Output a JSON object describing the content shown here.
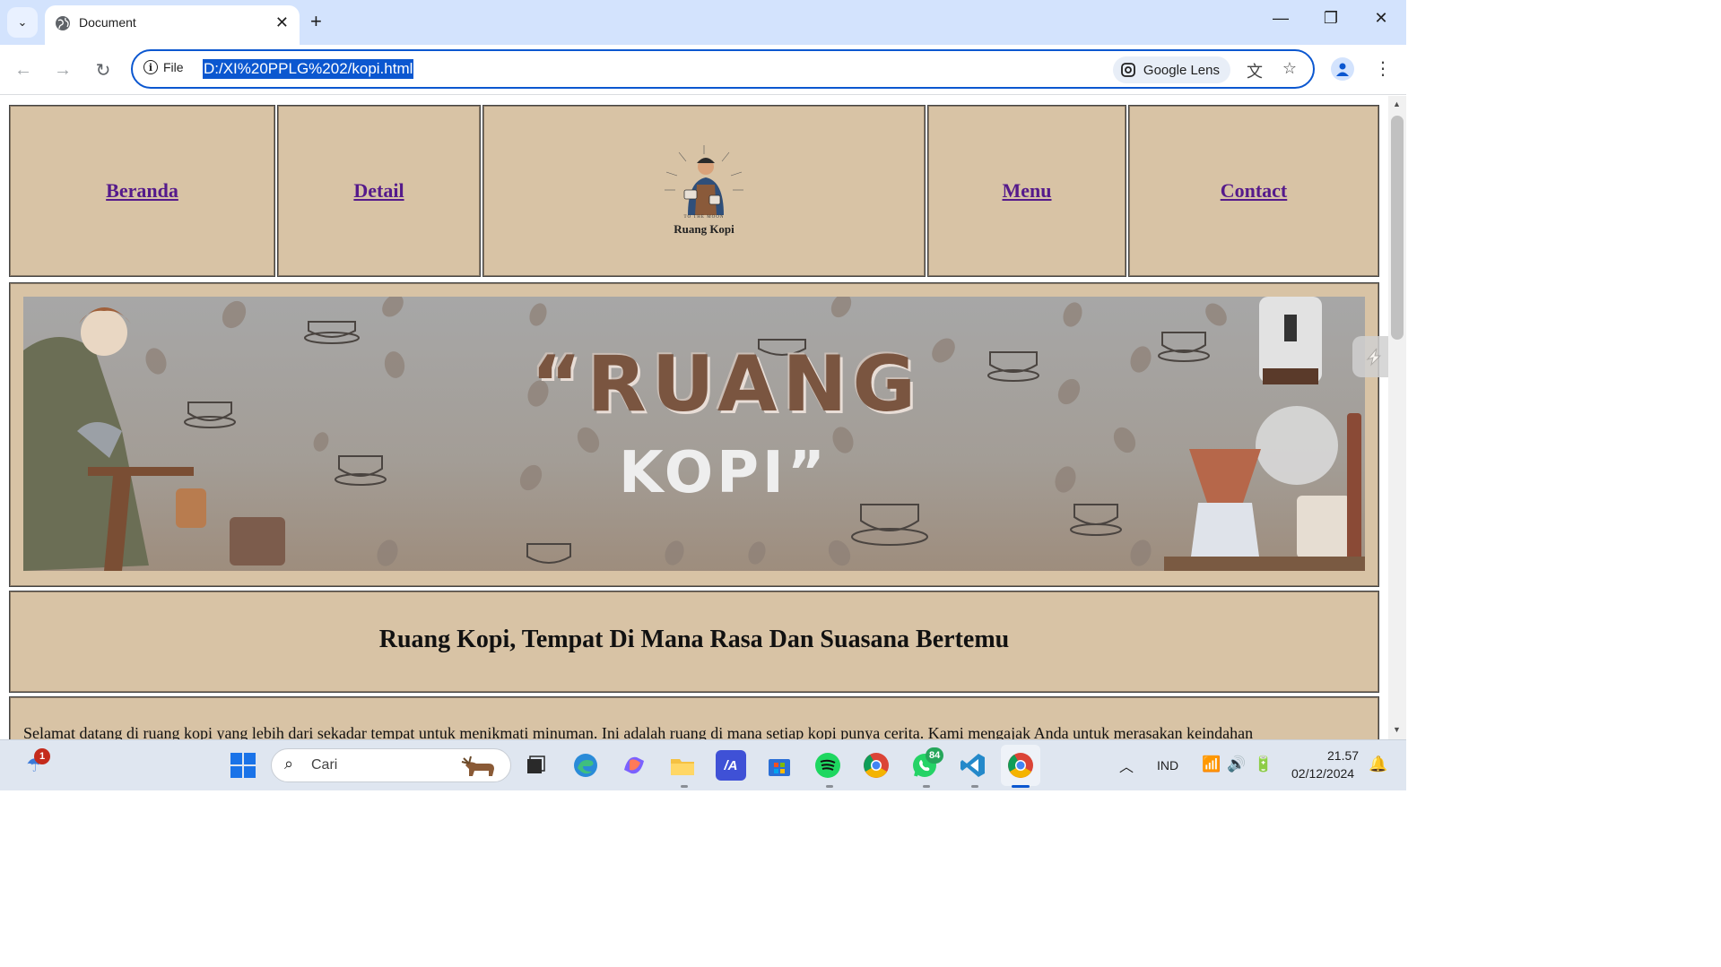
{
  "browser": {
    "tab_title": "Document",
    "url_scheme_label": "File",
    "url": "D:/XI%20PPLG%202/kopi.html",
    "lens_label": "Google Lens"
  },
  "site": {
    "nav": {
      "beranda": "Beranda",
      "detail": "Detail",
      "menu": "Menu",
      "contact": "Contact"
    },
    "logo_name": "Ruang Kopi",
    "logo_tagline": "TO THE MOON",
    "banner_line1": "“RUANG",
    "banner_line2": "KOPI”",
    "heading": "Ruang Kopi, Tempat Di Mana Rasa Dan Suasana Bertemu",
    "intro": "Selamat datang di ruang kopi yang lebih dari sekadar tempat untuk menikmati minuman. Ini adalah ruang di mana setiap kopi punya cerita. Kami mengajak Anda untuk merasakan keindahan"
  },
  "colors": {
    "cell_bg": "#d8c3a5",
    "link": "#551a8b",
    "accent": "#0b57d0"
  },
  "taskbar": {
    "search_placeholder": "Cari",
    "notif_badge": "1",
    "whatsapp_badge": "84",
    "language": "IND",
    "time": "21.57",
    "date": "02/12/2024"
  }
}
